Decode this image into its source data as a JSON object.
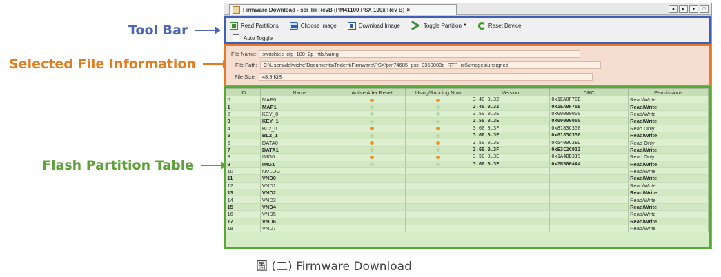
{
  "annotations": {
    "toolbar": "Tool Bar",
    "file_info": "Selected File Information",
    "flash_table": "Flash Partition Table"
  },
  "window": {
    "tab_title": "Firmware Download - ser Tri RevB (PM41100 PSX 100x Rev B)",
    "tab_close": "×",
    "buttons": [
      "◂",
      "▸",
      "▾",
      "□"
    ]
  },
  "toolbar": {
    "read_partitions": "Read Partitions",
    "choose_image": "Choose Image",
    "download_image": "Download Image",
    "toggle_partition": "Toggle Partition",
    "toggle_caret": "▼",
    "reset_device": "Reset Device",
    "auto_toggle": "Auto Toggle",
    "colors": {
      "border": "#3f5fb5"
    }
  },
  "file_info": {
    "name_label": "File Name:",
    "name_value": "switchtec_cfg_100_2p_ntb.fwimg",
    "path_label": "File Path:",
    "path_value": "C:\\Users\\delwiche\\Documents\\Trident\\Firmware\\PSX\\pm74685_psx_0350003e_RTP_rc5\\images\\unsigned",
    "size_label": "File Size:",
    "size_value": "48.9 KiB",
    "colors": {
      "border": "#e8782a",
      "background": "#f5ddd0"
    }
  },
  "table": {
    "headers": [
      "ID",
      "Name",
      "Active After Reset",
      "Using/Running Now",
      "Version",
      "CRC",
      "Permissions"
    ],
    "rows": [
      {
        "id": "0",
        "name": "MAP0",
        "active": true,
        "running": true,
        "version": "3.40.0.32",
        "crc": "0x1EA0F70B",
        "perm": "Read/Write"
      },
      {
        "id": "1",
        "name": "MAP1",
        "active": false,
        "running": false,
        "version": "3.40.0.32",
        "crc": "0x1EA0F70B",
        "perm": "Read/Write"
      },
      {
        "id": "2",
        "name": "KEY_0",
        "active": false,
        "running": false,
        "version": "3.50.0.3E",
        "crc": "0x00000000",
        "perm": "Read/Write"
      },
      {
        "id": "3",
        "name": "KEY_1",
        "active": false,
        "running": false,
        "version": "3.50.0.3E",
        "crc": "0x00000000",
        "perm": "Read/Write"
      },
      {
        "id": "4",
        "name": "BL2_0",
        "active": true,
        "running": true,
        "version": "3.60.0.3F",
        "crc": "0x8183C350",
        "perm": "Read Only"
      },
      {
        "id": "5",
        "name": "BL2_1",
        "active": false,
        "running": false,
        "version": "3.60.0.3F",
        "crc": "0x8183C350",
        "perm": "Read/Write"
      },
      {
        "id": "6",
        "name": "DATA0",
        "active": true,
        "running": true,
        "version": "3.50.0.3E",
        "crc": "0x5409C3ED",
        "perm": "Read Only"
      },
      {
        "id": "7",
        "name": "DATA1",
        "active": false,
        "running": false,
        "version": "3.60.0.3F",
        "crc": "0xE3C2C913",
        "perm": "Read/Write"
      },
      {
        "id": "8",
        "name": "IMG0",
        "active": true,
        "running": true,
        "version": "3.50.0.3E",
        "crc": "0x1A4BB319",
        "perm": "Read Only"
      },
      {
        "id": "9",
        "name": "IMG1",
        "active": false,
        "running": false,
        "version": "3.60.0.3F",
        "crc": "0x2B500AA4",
        "perm": "Read/Write"
      },
      {
        "id": "10",
        "name": "NVLOG",
        "active": null,
        "running": null,
        "version": "",
        "crc": "",
        "perm": "Read/Write"
      },
      {
        "id": "11",
        "name": "VND0",
        "active": null,
        "running": null,
        "version": "",
        "crc": "",
        "perm": "Read/Write"
      },
      {
        "id": "12",
        "name": "VND1",
        "active": null,
        "running": null,
        "version": "",
        "crc": "",
        "perm": "Read/Write"
      },
      {
        "id": "13",
        "name": "VND2",
        "active": null,
        "running": null,
        "version": "",
        "crc": "",
        "perm": "Read/Write"
      },
      {
        "id": "14",
        "name": "VND3",
        "active": null,
        "running": null,
        "version": "",
        "crc": "",
        "perm": "Read/Write"
      },
      {
        "id": "15",
        "name": "VND4",
        "active": null,
        "running": null,
        "version": "",
        "crc": "",
        "perm": "Read/Write"
      },
      {
        "id": "16",
        "name": "VND5",
        "active": null,
        "running": null,
        "version": "",
        "crc": "",
        "perm": "Read/Write"
      },
      {
        "id": "17",
        "name": "VND6",
        "active": null,
        "running": null,
        "version": "",
        "crc": "",
        "perm": "Read/Write"
      },
      {
        "id": "18",
        "name": "VND7",
        "active": null,
        "running": null,
        "version": "",
        "crc": "",
        "perm": "Read/Write"
      }
    ],
    "colors": {
      "border": "#58a838",
      "background": "#d6ecc6",
      "active_dot": "#f0902a",
      "inactive_dot": "#b8d8a8"
    }
  },
  "caption": "圖 (二) Firmware Download"
}
